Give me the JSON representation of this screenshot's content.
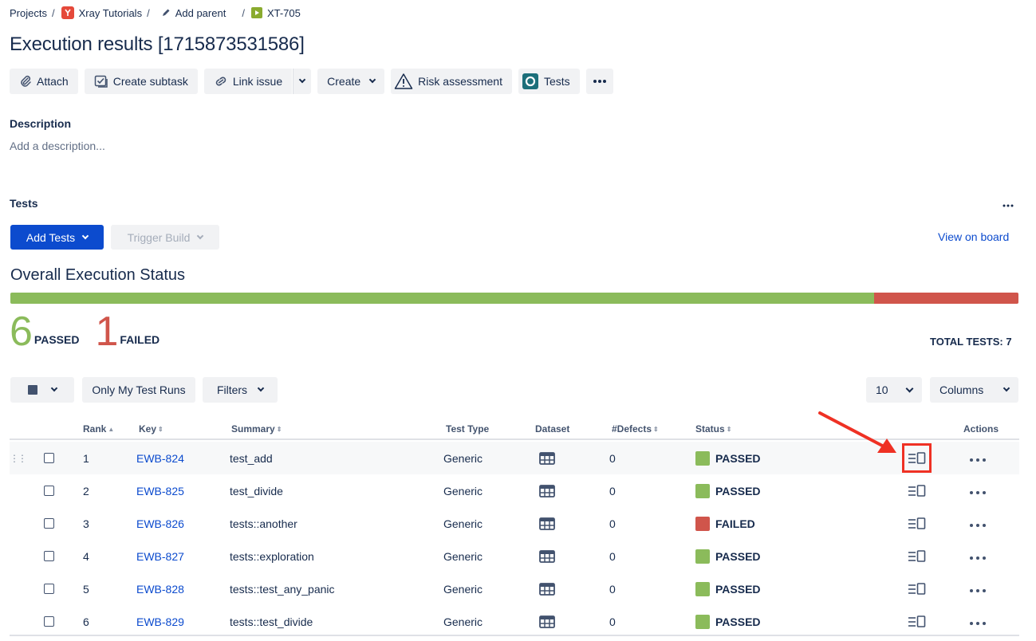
{
  "breadcrumb": {
    "projects": "Projects",
    "project": "Xray Tutorials",
    "add_parent": "Add parent",
    "issue_key": "XT-705",
    "separator": "/"
  },
  "title": "Execution results [1715873531586]",
  "toolbar": {
    "attach": "Attach",
    "create_subtask": "Create subtask",
    "link_issue": "Link issue",
    "create": "Create",
    "risk_assessment": "Risk assessment",
    "tests": "Tests"
  },
  "description": {
    "label": "Description",
    "placeholder": "Add a description..."
  },
  "tests_section": {
    "label": "Tests",
    "add_tests": "Add Tests",
    "trigger_build": "Trigger Build",
    "view_on_board": "View on board"
  },
  "overall": {
    "heading": "Overall Execution Status",
    "passed_count": "6",
    "passed_label": "PASSED",
    "failed_count": "1",
    "failed_label": "FAILED",
    "total_label": "TOTAL TESTS: 7",
    "passed_fraction": 0.857,
    "failed_fraction": 0.143
  },
  "filters": {
    "only_my_runs": "Only My Test Runs",
    "filters": "Filters",
    "page_size": "10",
    "columns": "Columns"
  },
  "table": {
    "headers": {
      "rank": "Rank",
      "key": "Key",
      "summary": "Summary",
      "test_type": "Test Type",
      "dataset": "Dataset",
      "defects": "#Defects",
      "status": "Status",
      "actions": "Actions"
    },
    "rows": [
      {
        "rank": "1",
        "key": "EWB-824",
        "summary": "test_add",
        "type": "Generic",
        "defects": "0",
        "status": "PASSED"
      },
      {
        "rank": "2",
        "key": "EWB-825",
        "summary": "test_divide",
        "type": "Generic",
        "defects": "0",
        "status": "PASSED"
      },
      {
        "rank": "3",
        "key": "EWB-826",
        "summary": "tests::another",
        "type": "Generic",
        "defects": "0",
        "status": "FAILED"
      },
      {
        "rank": "4",
        "key": "EWB-827",
        "summary": "tests::exploration",
        "type": "Generic",
        "defects": "0",
        "status": "PASSED"
      },
      {
        "rank": "5",
        "key": "EWB-828",
        "summary": "tests::test_any_panic",
        "type": "Generic",
        "defects": "0",
        "status": "PASSED"
      },
      {
        "rank": "6",
        "key": "EWB-829",
        "summary": "tests::test_divide",
        "type": "Generic",
        "defects": "0",
        "status": "PASSED"
      }
    ]
  },
  "colors": {
    "passed": "#8bbb5b",
    "failed": "#d0554b",
    "primary": "#0c4bce",
    "annotation": "#ef3124"
  },
  "icons": {
    "dataset": "table-grid-icon",
    "details": "execution-details-icon",
    "actions": "more-dots-icon"
  }
}
